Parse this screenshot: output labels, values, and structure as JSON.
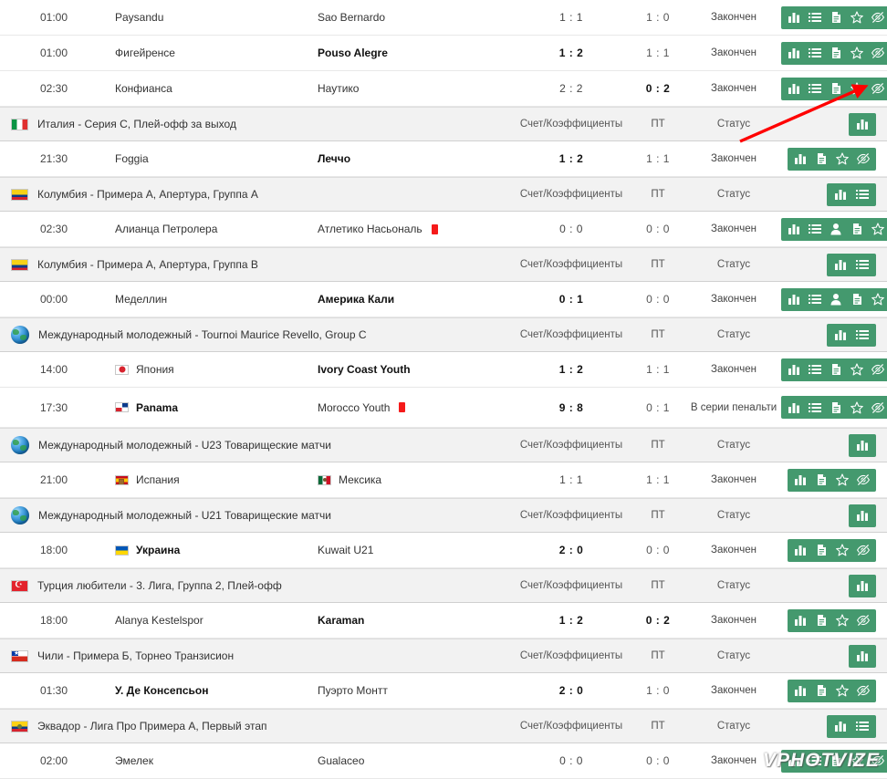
{
  "column_headers": {
    "score": "Счет/Коэффициенты",
    "halftime": "ПТ",
    "status": "Статус"
  },
  "status_labels": {
    "finished": "Закончен",
    "penalties": "В серии пенальти"
  },
  "colors": {
    "icon_bar_green": "#44996e",
    "league_row_bg": "#f2f2f2",
    "match_row_bg": "#ffffff",
    "red_card": "#f51a1a",
    "annotation_arrow": "#ff0000"
  },
  "icons": {
    "chart": "bar-chart-icon",
    "list": "list-icon",
    "person": "person-icon",
    "document": "document-icon",
    "star": "star-icon",
    "eye_slash": "eye-slash-icon"
  },
  "watermark": "VPHOTVIZE",
  "rows": [
    {
      "kind": "match",
      "time": "01:00",
      "home": {
        "name": "Paysandu",
        "bold": false,
        "flag": null,
        "red_card": false
      },
      "away": {
        "name": "Sao Bernardo",
        "bold": false,
        "flag": null,
        "red_card": false
      },
      "score": "1 : 1",
      "score_bold": false,
      "halftime": "1 : 0",
      "halftime_bold": false,
      "status": "Закончен",
      "actions": [
        "chart",
        "list",
        "document",
        "star",
        "eye_slash"
      ]
    },
    {
      "kind": "match",
      "time": "01:00",
      "home": {
        "name": "Фигейренсе",
        "bold": false,
        "flag": null,
        "red_card": false
      },
      "away": {
        "name": "Pouso Alegre",
        "bold": true,
        "flag": null,
        "red_card": false
      },
      "score": "1 : 2",
      "score_bold": true,
      "halftime": "1 : 1",
      "halftime_bold": false,
      "status": "Закончен",
      "actions": [
        "chart",
        "list",
        "document",
        "star",
        "eye_slash"
      ]
    },
    {
      "kind": "match",
      "time": "02:30",
      "home": {
        "name": "Конфианса",
        "bold": false,
        "flag": null,
        "red_card": false
      },
      "away": {
        "name": "Наутико",
        "bold": false,
        "flag": null,
        "red_card": false
      },
      "score": "2 : 2",
      "score_bold": false,
      "halftime": "0 : 2",
      "halftime_bold": true,
      "status": "Закончен",
      "actions": [
        "chart",
        "list",
        "document",
        "star",
        "eye_slash"
      ]
    },
    {
      "kind": "league",
      "name": "Италия - Серия С, Плей-офф за выход",
      "flag": "italy",
      "actions": [
        "chart"
      ]
    },
    {
      "kind": "match",
      "time": "21:30",
      "home": {
        "name": "Foggia",
        "bold": false,
        "flag": null,
        "red_card": false
      },
      "away": {
        "name": "Леччо",
        "bold": true,
        "flag": null,
        "red_card": false
      },
      "score": "1 : 2",
      "score_bold": true,
      "halftime": "1 : 1",
      "halftime_bold": false,
      "status": "Закончен",
      "actions": [
        "chart",
        "document",
        "star",
        "eye_slash"
      ]
    },
    {
      "kind": "league",
      "name": "Колумбия - Примера А, Апертура, Группа А",
      "flag": "colombia",
      "actions": [
        "chart",
        "list"
      ]
    },
    {
      "kind": "match",
      "time": "02:30",
      "home": {
        "name": "Алианца Петролера",
        "bold": false,
        "flag": null,
        "red_card": false
      },
      "away": {
        "name": "Атлетико Насьональ",
        "bold": false,
        "flag": null,
        "red_card": true
      },
      "score": "0 : 0",
      "score_bold": false,
      "halftime": "0 : 0",
      "halftime_bold": false,
      "status": "Закончен",
      "actions": [
        "chart",
        "list",
        "person",
        "document",
        "star",
        "eye_slash"
      ]
    },
    {
      "kind": "league",
      "name": "Колумбия - Примера А, Апертура, Группа В",
      "flag": "colombia",
      "actions": [
        "chart",
        "list"
      ]
    },
    {
      "kind": "match",
      "time": "00:00",
      "home": {
        "name": "Меделлин",
        "bold": false,
        "flag": null,
        "red_card": false
      },
      "away": {
        "name": "Америка Кали",
        "bold": true,
        "flag": null,
        "red_card": false
      },
      "score": "0 : 1",
      "score_bold": true,
      "halftime": "0 : 0",
      "halftime_bold": false,
      "status": "Закончен",
      "actions": [
        "chart",
        "list",
        "person",
        "document",
        "star",
        "eye_slash"
      ]
    },
    {
      "kind": "league",
      "name": "Международный молодежный - Tournoi Maurice Revello, Group C",
      "flag": "globe",
      "actions": [
        "chart",
        "list"
      ]
    },
    {
      "kind": "match",
      "time": "14:00",
      "home": {
        "name": "Япония",
        "bold": false,
        "flag": "japan",
        "red_card": false
      },
      "away": {
        "name": "Ivory Coast Youth",
        "bold": true,
        "flag": null,
        "red_card": false
      },
      "score": "1 : 2",
      "score_bold": true,
      "halftime": "1 : 1",
      "halftime_bold": false,
      "status": "Закончен",
      "actions": [
        "chart",
        "list",
        "document",
        "star",
        "eye_slash"
      ]
    },
    {
      "kind": "match",
      "tall": true,
      "time": "17:30",
      "home": {
        "name": "Panama",
        "bold": true,
        "flag": "panama",
        "red_card": false
      },
      "away": {
        "name": "Morocco Youth",
        "bold": false,
        "flag": null,
        "red_card": true
      },
      "score": "9 : 8",
      "score_bold": true,
      "halftime": "0 : 1",
      "halftime_bold": false,
      "status": "В серии пенальти",
      "actions": [
        "chart",
        "list",
        "document",
        "star",
        "eye_slash"
      ]
    },
    {
      "kind": "league",
      "name": "Международный молодежный - U23 Товарищеские матчи",
      "flag": "globe",
      "actions": [
        "chart"
      ]
    },
    {
      "kind": "match",
      "time": "21:00",
      "home": {
        "name": "Испания",
        "bold": false,
        "flag": "spain",
        "red_card": false
      },
      "away": {
        "name": "Мексика",
        "bold": false,
        "flag": "mexico",
        "red_card": false
      },
      "score": "1 : 1",
      "score_bold": false,
      "halftime": "1 : 1",
      "halftime_bold": false,
      "status": "Закончен",
      "actions": [
        "chart",
        "document",
        "star",
        "eye_slash"
      ]
    },
    {
      "kind": "league",
      "name": "Международный молодежный - U21 Товарищеские матчи",
      "flag": "globe",
      "actions": [
        "chart"
      ]
    },
    {
      "kind": "match",
      "time": "18:00",
      "home": {
        "name": "Украина",
        "bold": true,
        "flag": "ukraine",
        "red_card": false
      },
      "away": {
        "name": "Kuwait U21",
        "bold": false,
        "flag": null,
        "red_card": false
      },
      "score": "2 : 0",
      "score_bold": true,
      "halftime": "0 : 0",
      "halftime_bold": false,
      "status": "Закончен",
      "actions": [
        "chart",
        "document",
        "star",
        "eye_slash"
      ]
    },
    {
      "kind": "league",
      "name": "Турция любители - 3. Лига, Группа 2, Плей-офф",
      "flag": "turkey",
      "actions": [
        "chart"
      ]
    },
    {
      "kind": "match",
      "time": "18:00",
      "home": {
        "name": "Alanya Kestelspor",
        "bold": false,
        "flag": null,
        "red_card": false
      },
      "away": {
        "name": "Karaman",
        "bold": true,
        "flag": null,
        "red_card": false
      },
      "score": "1 : 2",
      "score_bold": true,
      "halftime": "0 : 2",
      "halftime_bold": true,
      "status": "Закончен",
      "actions": [
        "chart",
        "document",
        "star",
        "eye_slash"
      ]
    },
    {
      "kind": "league",
      "name": "Чили - Примера Б, Торнео Транзисион",
      "flag": "chile",
      "actions": [
        "chart"
      ]
    },
    {
      "kind": "match",
      "time": "01:30",
      "home": {
        "name": "У. Де Консепсьон",
        "bold": true,
        "flag": null,
        "red_card": false
      },
      "away": {
        "name": "Пуэрто Монтт",
        "bold": false,
        "flag": null,
        "red_card": false
      },
      "score": "2 : 0",
      "score_bold": true,
      "halftime": "1 : 0",
      "halftime_bold": false,
      "status": "Закончен",
      "actions": [
        "chart",
        "document",
        "star",
        "eye_slash"
      ]
    },
    {
      "kind": "league",
      "name": "Эквадор - Лига Про Примера А, Первый этап",
      "flag": "ecuador",
      "actions": [
        "chart",
        "list"
      ]
    },
    {
      "kind": "match",
      "time": "02:00",
      "home": {
        "name": "Эмелек",
        "bold": false,
        "flag": null,
        "red_card": false
      },
      "away": {
        "name": "Gualaceo",
        "bold": false,
        "flag": null,
        "red_card": false
      },
      "score": "0 : 0",
      "score_bold": false,
      "halftime": "0 : 0",
      "halftime_bold": false,
      "status": "Закончен",
      "actions": [
        "chart",
        "list",
        "document",
        "star",
        "eye_slash"
      ]
    }
  ]
}
